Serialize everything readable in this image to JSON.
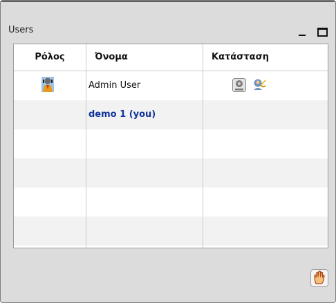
{
  "window": {
    "title": "Users",
    "minimize_icon": "minimize-icon",
    "maximize_icon": "maximize-icon"
  },
  "table": {
    "columns": [
      "Ρόλος",
      "Όνομα",
      "Κατάσταση"
    ],
    "rows": [
      {
        "role_icon": "moderator-icon",
        "name": "Admin User",
        "status_icons": [
          "webcam-icon",
          "microphone-icon"
        ]
      },
      {
        "name": "demo 1 (you)"
      }
    ]
  },
  "footer": {
    "raise_hand_icon": "raise-hand-icon"
  },
  "colors": {
    "panel_bg": "#dcdcdc",
    "you_name": "#12359a"
  }
}
